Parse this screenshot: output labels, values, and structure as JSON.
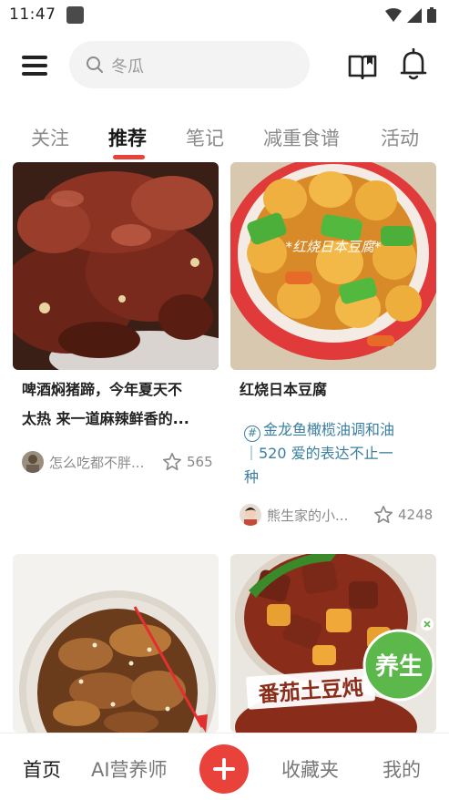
{
  "status_bar": {
    "time": "11:47"
  },
  "header": {
    "search_placeholder": "冬瓜"
  },
  "tabs": [
    {
      "label": "关注",
      "active": false
    },
    {
      "label": "推荐",
      "active": true
    },
    {
      "label": "笔记",
      "active": false
    },
    {
      "label": "减重食谱",
      "active": false
    },
    {
      "label": "活动",
      "active": false
    }
  ],
  "feed": {
    "cards": [
      {
        "title_line1": "啤酒焖猪蹄，今年夏天不",
        "title_line2": "太热 来一道麻辣鲜香的...",
        "author": "怎么吃都不胖...",
        "likes": "565"
      },
      {
        "image_text": "*红烧日本豆腐*",
        "title": "红烧日本豆腐",
        "topic_hash": "#",
        "topic_line1": "金龙鱼橄榄油调和油",
        "topic_line2": "｜520 爱的表达不止一",
        "topic_line3": "种",
        "author": "熊生家的小...",
        "likes": "4248"
      },
      {},
      {
        "image_text": "番茄土豆炖",
        "badge": "养生"
      }
    ]
  },
  "bottom_nav": {
    "home": "首页",
    "ai": "AI营养师",
    "favorites": "收藏夹",
    "me": "我的"
  },
  "colors": {
    "accent": "#e8423a",
    "topic": "#3a7fa0",
    "muted": "#8a8a8a",
    "badge": "#5cb84a"
  }
}
